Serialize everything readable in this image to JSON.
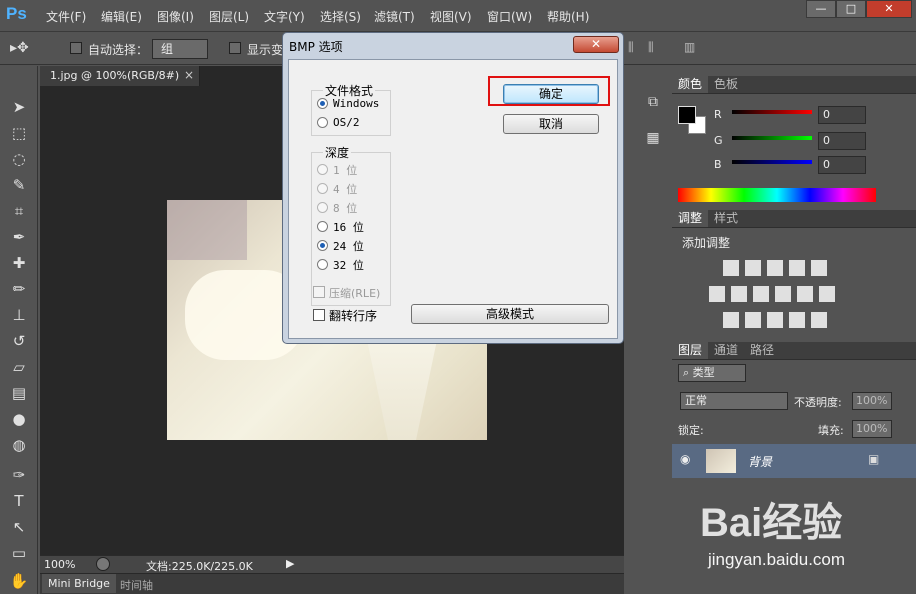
{
  "app": {
    "logo": "Ps"
  },
  "menu": [
    "文件(F)",
    "编辑(E)",
    "图像(I)",
    "图层(L)",
    "文字(Y)",
    "选择(S)",
    "滤镜(T)",
    "视图(V)",
    "窗口(W)",
    "帮助(H)"
  ],
  "window_controls": {
    "minimize": "—",
    "maximize": "□",
    "close": "✕"
  },
  "options": {
    "auto_select_label": "自动选择：",
    "auto_select_value": "组",
    "show_transform_label": "显示变"
  },
  "document": {
    "tab_title": "1.jpg @ 100%(RGB/8#)",
    "tab_close": "×",
    "zoom": "100%",
    "doc_info": "文档:225.0K/225.0K"
  },
  "bottom_tabs": [
    "Mini Bridge",
    "时间轴"
  ],
  "dialog": {
    "title": "BMP 选项",
    "close": "✕",
    "format_group": "文件格式",
    "formats": [
      {
        "label": "Windows",
        "selected": true
      },
      {
        "label": "OS/2",
        "selected": false
      }
    ],
    "depth_group": "深度",
    "depths": [
      {
        "label": "1 位",
        "selected": false,
        "disabled": true
      },
      {
        "label": "4 位",
        "selected": false,
        "disabled": true
      },
      {
        "label": "8 位",
        "selected": false,
        "disabled": true
      },
      {
        "label": "16 位",
        "selected": false,
        "disabled": false
      },
      {
        "label": "24 位",
        "selected": true,
        "disabled": false
      },
      {
        "label": "32 位",
        "selected": false,
        "disabled": false
      }
    ],
    "compress_label": "压缩(RLE)",
    "flip_label": "翻转行序",
    "ok_label": "确定",
    "cancel_label": "取消",
    "advanced_label": "高级模式"
  },
  "color_panel": {
    "tabs": [
      "颜色",
      "色板"
    ],
    "channels": [
      {
        "name": "R",
        "value": "0",
        "color": "#ff0000"
      },
      {
        "name": "G",
        "value": "0",
        "color": "#00ff00"
      },
      {
        "name": "B",
        "value": "0",
        "color": "#0000ff"
      }
    ]
  },
  "adjust_panel": {
    "tabs": [
      "调整",
      "样式"
    ],
    "heading": "添加调整"
  },
  "layers_panel": {
    "tabs": [
      "图层",
      "通道",
      "路径"
    ],
    "filter_label": "类型",
    "blend_mode": "正常",
    "opacity_label": "不透明度:",
    "opacity_value": "100%",
    "lock_label": "锁定:",
    "fill_label": "填充:",
    "fill_value": "100%",
    "layer_name": "背景"
  },
  "watermark": {
    "brand": "Bai经验",
    "url": "jingyan.baidu.com"
  }
}
